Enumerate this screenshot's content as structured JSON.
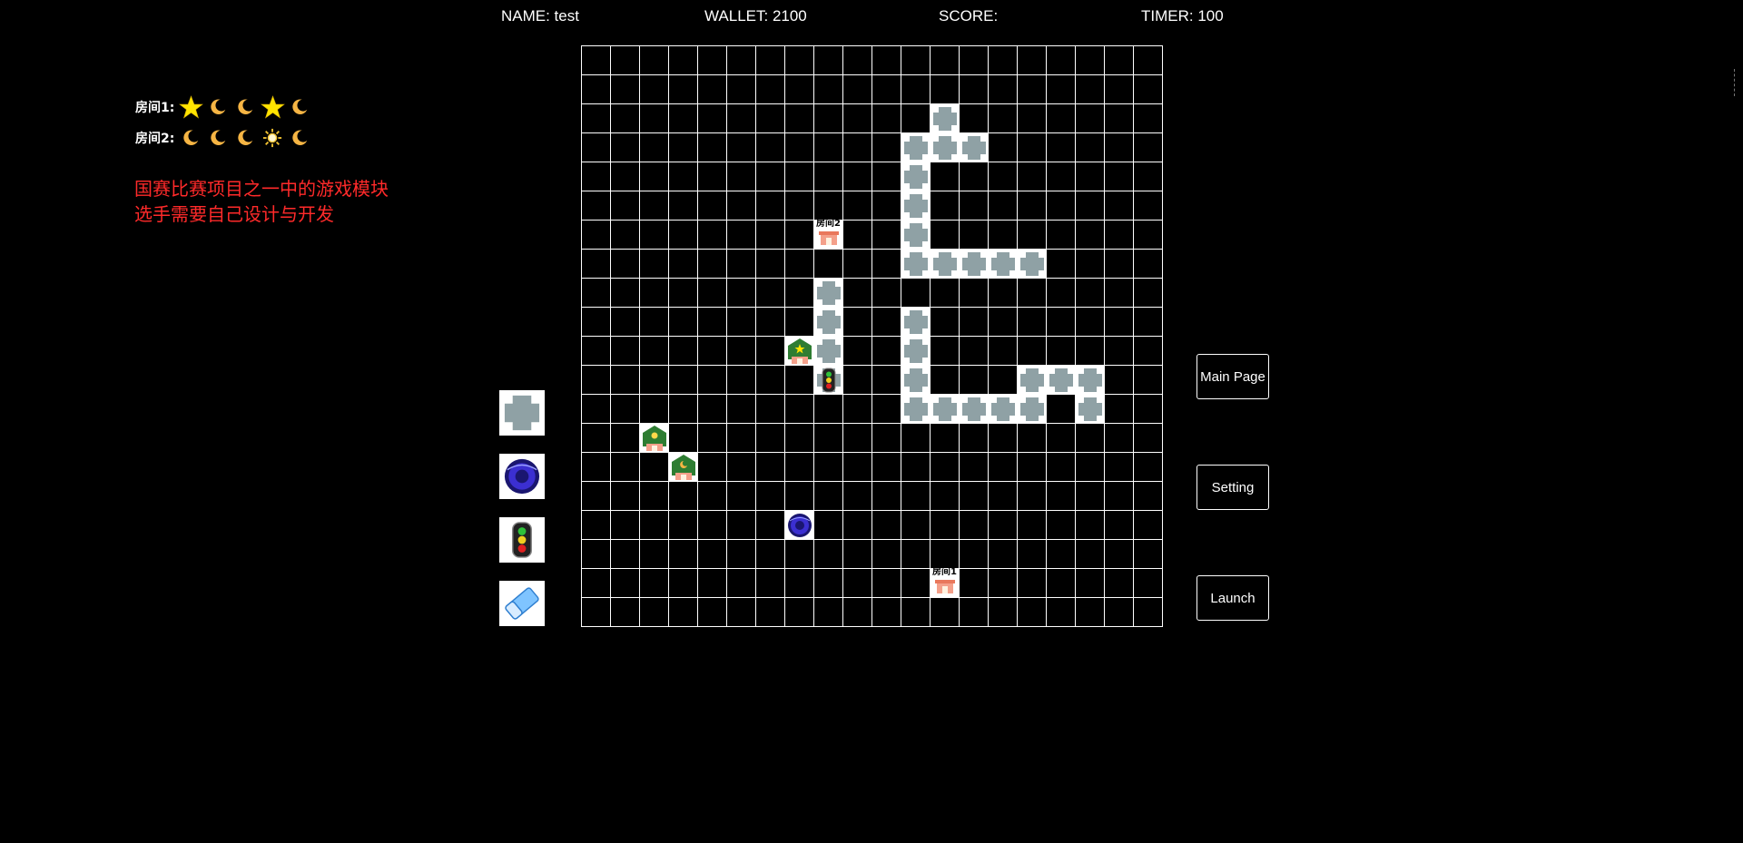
{
  "hud": {
    "name": "NAME: test",
    "wallet": "WALLET: 2100",
    "score": "SCORE:",
    "timer": "TIMER: 100"
  },
  "legend": [
    {
      "label": "房间1:",
      "icons": [
        "star-icon",
        "moon-icon",
        "moon-icon",
        "star-icon",
        "moon-icon"
      ]
    },
    {
      "label": "房间2:",
      "icons": [
        "moon-icon",
        "moon-icon",
        "moon-icon",
        "sun-icon",
        "moon-icon"
      ]
    }
  ],
  "note": {
    "line1": "国赛比赛项目之一中的游戏模块",
    "line2": "选手需要自己设计与开发"
  },
  "palette": [
    {
      "name": "road-tile",
      "icon": "road-tile-icon"
    },
    {
      "name": "portal",
      "icon": "portal-icon"
    },
    {
      "name": "traffic-light",
      "icon": "traffic-light-icon"
    },
    {
      "name": "eraser",
      "icon": "eraser-icon"
    }
  ],
  "buttons": {
    "main_page": "Main Page",
    "setting": "Setting",
    "launch": "Launch"
  },
  "board": {
    "cols": 20,
    "rows": 20,
    "road": [
      [
        8,
        8
      ],
      [
        9,
        8
      ],
      [
        10,
        8
      ],
      [
        11,
        8
      ],
      [
        3,
        11
      ],
      [
        4,
        11
      ],
      [
        5,
        11
      ],
      [
        6,
        11
      ],
      [
        7,
        11
      ],
      [
        9,
        11
      ],
      [
        10,
        11
      ],
      [
        11,
        11
      ],
      [
        12,
        11
      ],
      [
        2,
        12
      ],
      [
        3,
        12
      ],
      [
        7,
        12
      ],
      [
        12,
        12
      ],
      [
        3,
        13
      ],
      [
        7,
        13
      ],
      [
        12,
        13
      ],
      [
        7,
        14
      ],
      [
        12,
        14
      ],
      [
        7,
        15
      ],
      [
        11,
        15
      ],
      [
        12,
        15
      ],
      [
        11,
        16
      ],
      [
        11,
        17
      ],
      [
        12,
        17
      ]
    ],
    "rooms": [
      {
        "row": 6,
        "col": 8,
        "label": "房间2"
      },
      {
        "row": 18,
        "col": 12,
        "label": "房间1"
      }
    ],
    "houses": [
      {
        "row": 10,
        "col": 7,
        "icon": "house-star-icon"
      },
      {
        "row": 13,
        "col": 2,
        "icon": "house-sun-icon"
      },
      {
        "row": 14,
        "col": 3,
        "icon": "house-moon-icon"
      }
    ],
    "traffic_lights": [
      {
        "row": 11,
        "col": 8
      }
    ],
    "portals": [
      {
        "row": 16,
        "col": 7
      }
    ]
  },
  "colors": {
    "note": "#ff2a2a",
    "road": "#8fa1a5",
    "house_roof": "#2e7d32",
    "portal": "#3b2fd1",
    "star": "#ffe400",
    "moon": "#f6b544"
  }
}
